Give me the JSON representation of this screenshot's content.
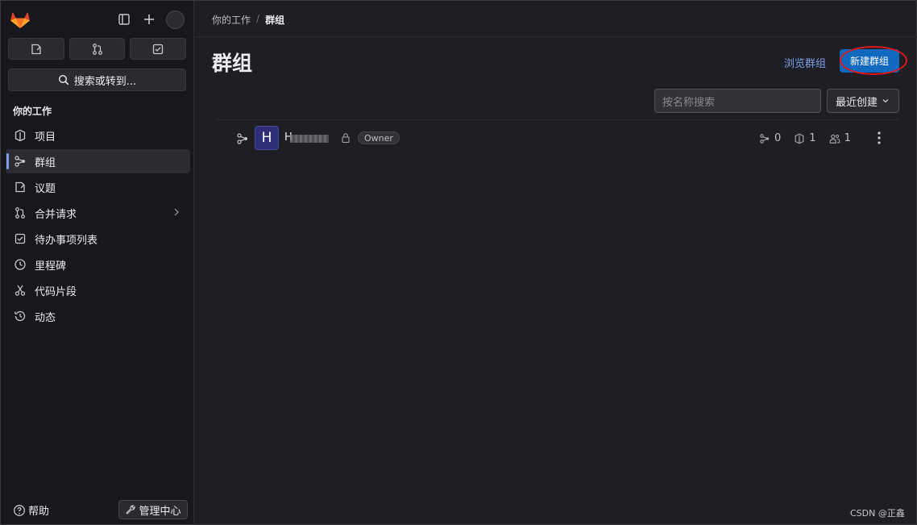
{
  "sidebar": {
    "search_label": "搜索或转到...",
    "section_title": "你的工作",
    "items": [
      {
        "label": "项目"
      },
      {
        "label": "群组"
      },
      {
        "label": "议题"
      },
      {
        "label": "合并请求"
      },
      {
        "label": "待办事项列表"
      },
      {
        "label": "里程碑"
      },
      {
        "label": "代码片段"
      },
      {
        "label": "动态"
      }
    ],
    "help_label": "帮助",
    "admin_label": "管理中心"
  },
  "breadcrumb": {
    "parent": "你的工作",
    "separator": "/",
    "current": "群组"
  },
  "page": {
    "title": "群组",
    "browse_link": "浏览群组",
    "new_group_button": "新建群组"
  },
  "filter": {
    "placeholder": "按名称搜索",
    "sort_label": "最近创建"
  },
  "groups": [
    {
      "avatar_letter": "H",
      "name": "H",
      "role": "Owner",
      "subgroups": "0",
      "projects": "1",
      "members": "1"
    }
  ],
  "watermark": "CSDN @正鑫",
  "colors": {
    "accent": "#1068bf",
    "link": "#7b9fea",
    "annotation": "#e0181b",
    "background": "#1f1e24",
    "sidebar": "#18171d"
  },
  "icons": {
    "logo": "gitlab-tanuki-icon",
    "sidebar_toggle": "sidebar-toggle-icon",
    "create": "plus-icon",
    "issues": "issues-icon",
    "merge_requests": "merge-request-icon",
    "todos": "todo-icon",
    "search": "search-icon",
    "project": "project-icon",
    "group": "group-icon",
    "milestone": "clock-icon",
    "snippet": "scissors-icon",
    "activity": "history-icon",
    "help": "help-icon",
    "admin": "wrench-icon",
    "lock": "lock-icon",
    "kebab": "more-vertical-icon"
  }
}
